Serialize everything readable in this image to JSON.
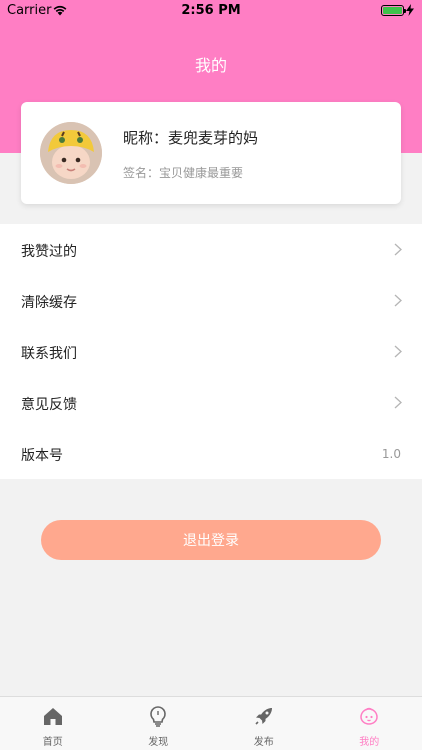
{
  "status_bar": {
    "carrier": "Carrier",
    "time": "2:56 PM"
  },
  "header": {
    "title": "我的"
  },
  "profile": {
    "nickname": "昵称：麦兜麦芽的妈",
    "signature": "签名：宝贝健康最重要"
  },
  "menu": {
    "items": [
      {
        "label": "我赞过的"
      },
      {
        "label": "清除缓存"
      },
      {
        "label": "联系我们"
      },
      {
        "label": "意见反馈"
      }
    ],
    "version_label": "版本号",
    "version_value": "1.0"
  },
  "logout_label": "退出登录",
  "tabbar": {
    "tabs": [
      {
        "label": "首页",
        "icon": "home-icon"
      },
      {
        "label": "发现",
        "icon": "bulb-icon"
      },
      {
        "label": "发布",
        "icon": "rocket-icon"
      },
      {
        "label": "我的",
        "icon": "baby-face-icon"
      }
    ],
    "active_color": "#ff7ec4"
  },
  "colors": {
    "header": "#ff7ec4",
    "logout": "#ffa88e",
    "battery": "#3ec24b"
  }
}
